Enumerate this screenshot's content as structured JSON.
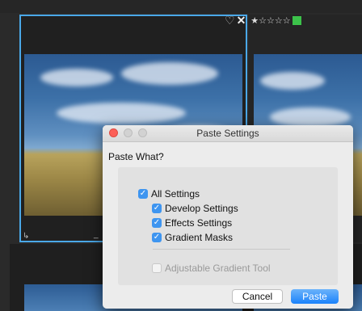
{
  "filmstrip": {
    "rating_heart": "♡",
    "rating_reject": "✕",
    "stars": [
      "★",
      "☆",
      "☆",
      "☆",
      "☆"
    ],
    "color_label": "#3cc24a",
    "accent_border": "#4aa8e8"
  },
  "dialog": {
    "title": "Paste Settings",
    "section_label": "Paste What?",
    "options": [
      {
        "label": "All Settings",
        "checked": true,
        "enabled": true
      },
      {
        "label": "Develop Settings",
        "checked": true,
        "enabled": true
      },
      {
        "label": "Effects Settings",
        "checked": true,
        "enabled": true
      },
      {
        "label": "Gradient Masks",
        "checked": true,
        "enabled": true
      },
      {
        "label": "Adjustable Gradient Tool",
        "checked": false,
        "enabled": false
      }
    ],
    "cancel_label": "Cancel",
    "paste_label": "Paste",
    "accent": "#3e95f0"
  }
}
